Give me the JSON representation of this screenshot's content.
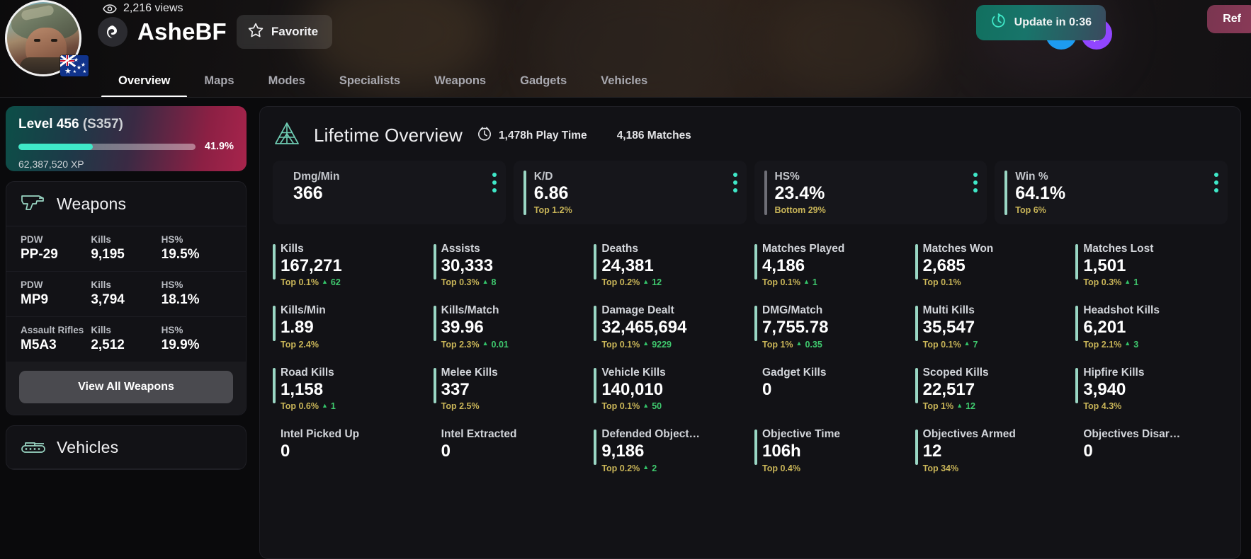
{
  "header": {
    "views": "2,216 views",
    "views_icon": "eye-icon",
    "username": "AsheBF",
    "name_badge_icon": "battlefield-logo-icon",
    "favorite_label": "Favorite",
    "favorite_icon": "star-icon",
    "flag_icon": "australia-flag-icon",
    "avatar_icon": "player-avatar",
    "update_label": "Update in 0:36",
    "update_icon": "timer-icon",
    "refresh_label": "Ref",
    "twitter_icon": "twitter-icon",
    "twitch_icon": "twitch-icon",
    "nav": [
      {
        "label": "Overview",
        "active": true
      },
      {
        "label": "Maps",
        "active": false
      },
      {
        "label": "Modes",
        "active": false
      },
      {
        "label": "Specialists",
        "active": false
      },
      {
        "label": "Weapons",
        "active": false
      },
      {
        "label": "Gadgets",
        "active": false
      },
      {
        "label": "Vehicles",
        "active": false
      }
    ]
  },
  "sidebar": {
    "level": {
      "title": "Level 456",
      "season": "(S357)",
      "progress_pct": "41.9%",
      "progress_value": 41.9,
      "xp": "62,387,520 XP"
    },
    "weapons_panel": {
      "title": "Weapons",
      "icon": "pistol-icon",
      "columns": [
        "PDW",
        "Kills",
        "HS%"
      ],
      "rows": [
        {
          "category": "PDW",
          "name": "PP-29",
          "kills_label": "Kills",
          "kills": "9,195",
          "hs_label": "HS%",
          "hs": "19.5%"
        },
        {
          "category": "PDW",
          "name": "MP9",
          "kills_label": "Kills",
          "kills": "3,794",
          "hs_label": "HS%",
          "hs": "18.1%"
        },
        {
          "category": "Assault Rifles",
          "name": "M5A3",
          "kills_label": "Kills",
          "kills": "2,512",
          "hs_label": "HS%",
          "hs": "19.9%"
        }
      ],
      "view_all_label": "View All Weapons"
    },
    "vehicles_panel": {
      "title": "Vehicles",
      "icon": "tank-icon"
    }
  },
  "main": {
    "title": "Lifetime Overview",
    "title_icon": "pyramid-icon",
    "play_time_icon": "clock-icon",
    "play_time": "1,478h Play Time",
    "matches": "4,186 Matches",
    "kpis": [
      {
        "label": "Dmg/Min",
        "value": "366",
        "sub": "",
        "bar": "none",
        "menu_icon": "more-vertical-icon"
      },
      {
        "label": "K/D",
        "value": "6.86",
        "sub": "Top 1.2%",
        "bar": "teal",
        "menu_icon": "more-vertical-icon"
      },
      {
        "label": "HS%",
        "value": "23.4%",
        "sub": "Bottom 29%",
        "bar": "gray",
        "menu_icon": "more-vertical-icon"
      },
      {
        "label": "Win %",
        "value": "64.1%",
        "sub": "Top 6%",
        "bar": "teal",
        "menu_icon": "more-vertical-icon"
      }
    ],
    "stats": [
      {
        "label": "Kills",
        "value": "167,271",
        "rank": "Top 0.1%",
        "delta": "62",
        "bar": true
      },
      {
        "label": "Assists",
        "value": "30,333",
        "rank": "Top 0.3%",
        "delta": "8",
        "bar": true
      },
      {
        "label": "Deaths",
        "value": "24,381",
        "rank": "Top 0.2%",
        "delta": "12",
        "bar": true
      },
      {
        "label": "Matches Played",
        "value": "4,186",
        "rank": "Top 0.1%",
        "delta": "1",
        "bar": true
      },
      {
        "label": "Matches Won",
        "value": "2,685",
        "rank": "Top 0.1%",
        "delta": "",
        "bar": true
      },
      {
        "label": "Matches Lost",
        "value": "1,501",
        "rank": "Top 0.3%",
        "delta": "1",
        "bar": true
      },
      {
        "label": "Kills/Min",
        "value": "1.89",
        "rank": "Top 2.4%",
        "delta": "",
        "bar": true
      },
      {
        "label": "Kills/Match",
        "value": "39.96",
        "rank": "Top 2.3%",
        "delta": "0.01",
        "bar": true
      },
      {
        "label": "Damage Dealt",
        "value": "32,465,694",
        "rank": "Top 0.1%",
        "delta": "9229",
        "bar": true
      },
      {
        "label": "DMG/Match",
        "value": "7,755.78",
        "rank": "Top 1%",
        "delta": "0.35",
        "bar": true
      },
      {
        "label": "Multi Kills",
        "value": "35,547",
        "rank": "Top 0.1%",
        "delta": "7",
        "bar": true
      },
      {
        "label": "Headshot Kills",
        "value": "6,201",
        "rank": "Top 2.1%",
        "delta": "3",
        "bar": true
      },
      {
        "label": "Road Kills",
        "value": "1,158",
        "rank": "Top 0.6%",
        "delta": "1",
        "bar": true
      },
      {
        "label": "Melee Kills",
        "value": "337",
        "rank": "Top 2.5%",
        "delta": "",
        "bar": true
      },
      {
        "label": "Vehicle Kills",
        "value": "140,010",
        "rank": "Top 0.1%",
        "delta": "50",
        "bar": true
      },
      {
        "label": "Gadget Kills",
        "value": "0",
        "rank": "",
        "delta": "",
        "bar": false
      },
      {
        "label": "Scoped Kills",
        "value": "22,517",
        "rank": "Top 1%",
        "delta": "12",
        "bar": true
      },
      {
        "label": "Hipfire Kills",
        "value": "3,940",
        "rank": "Top 4.3%",
        "delta": "",
        "bar": true
      },
      {
        "label": "Intel Picked Up",
        "value": "0",
        "rank": "",
        "delta": "",
        "bar": false
      },
      {
        "label": "Intel Extracted",
        "value": "0",
        "rank": "",
        "delta": "",
        "bar": false
      },
      {
        "label": "Defended Object…",
        "value": "9,186",
        "rank": "Top 0.2%",
        "delta": "2",
        "bar": true
      },
      {
        "label": "Objective Time",
        "value": "106h",
        "rank": "Top 0.4%",
        "delta": "",
        "bar": true
      },
      {
        "label": "Objectives Armed",
        "value": "12",
        "rank": "Top 34%",
        "delta": "",
        "bar": true
      },
      {
        "label": "Objectives Disar…",
        "value": "0",
        "rank": "",
        "delta": "",
        "bar": false
      }
    ]
  },
  "colors": {
    "accent_teal": "#3fe8c8",
    "rank_gold": "#c9b558",
    "delta_green": "#3fc96e",
    "bar_teal": "#9ad7c4",
    "bar_gray": "#6e6e76",
    "panel_bg": "#121216",
    "page_bg": "#0a0a0c"
  }
}
